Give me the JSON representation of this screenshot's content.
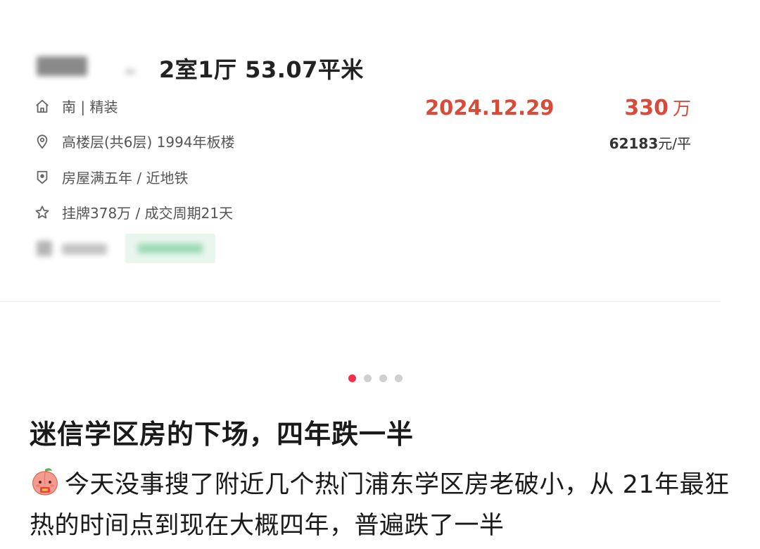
{
  "listing": {
    "title": "2室1厅 53.07平米",
    "attributes": [
      {
        "icon": "house-icon",
        "text": "南 | 精装"
      },
      {
        "icon": "location-pin-icon",
        "text": "高楼层(共6层) 1994年板楼"
      },
      {
        "icon": "shield-icon",
        "text": "房屋满五年 / 近地铁"
      },
      {
        "icon": "star-icon",
        "text": "挂牌378万 / 成交周期21天"
      }
    ],
    "deal_date": "2024.12.29",
    "price_value": "330",
    "price_unit": "万",
    "unit_price_value": "62183",
    "unit_price_suffix": "元/平"
  },
  "carousel": {
    "total": 4,
    "active": 0
  },
  "post": {
    "title": "迷信学区房的下场，四年跌一半",
    "body": "今天没事搜了附近几个热门浦东学区房老破小，从 21年最狂热的时间点到现在大概四年，普遍跌了一半"
  },
  "colors": {
    "accent_red": "#d84a3a",
    "active_dot": "#f0304a",
    "tag_green": "#5cc48a"
  }
}
